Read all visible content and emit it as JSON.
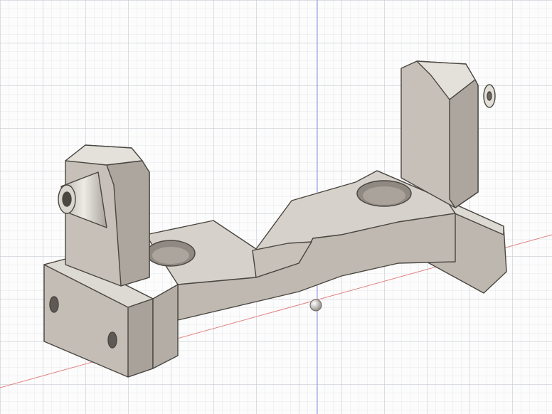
{
  "viewport": {
    "background_color": "#fcfcfc",
    "grid_color": "#c9ced6",
    "x_axis_color": "#e08080",
    "z_axis_color": "#8c8ce6"
  },
  "model": {
    "body_color": "#c9c4bd",
    "top_face_color": "#ddd9d3",
    "shadow_color": "#a39d95",
    "edge_color": "#4a4640"
  },
  "icons": {
    "origin": "origin-sphere-icon"
  }
}
